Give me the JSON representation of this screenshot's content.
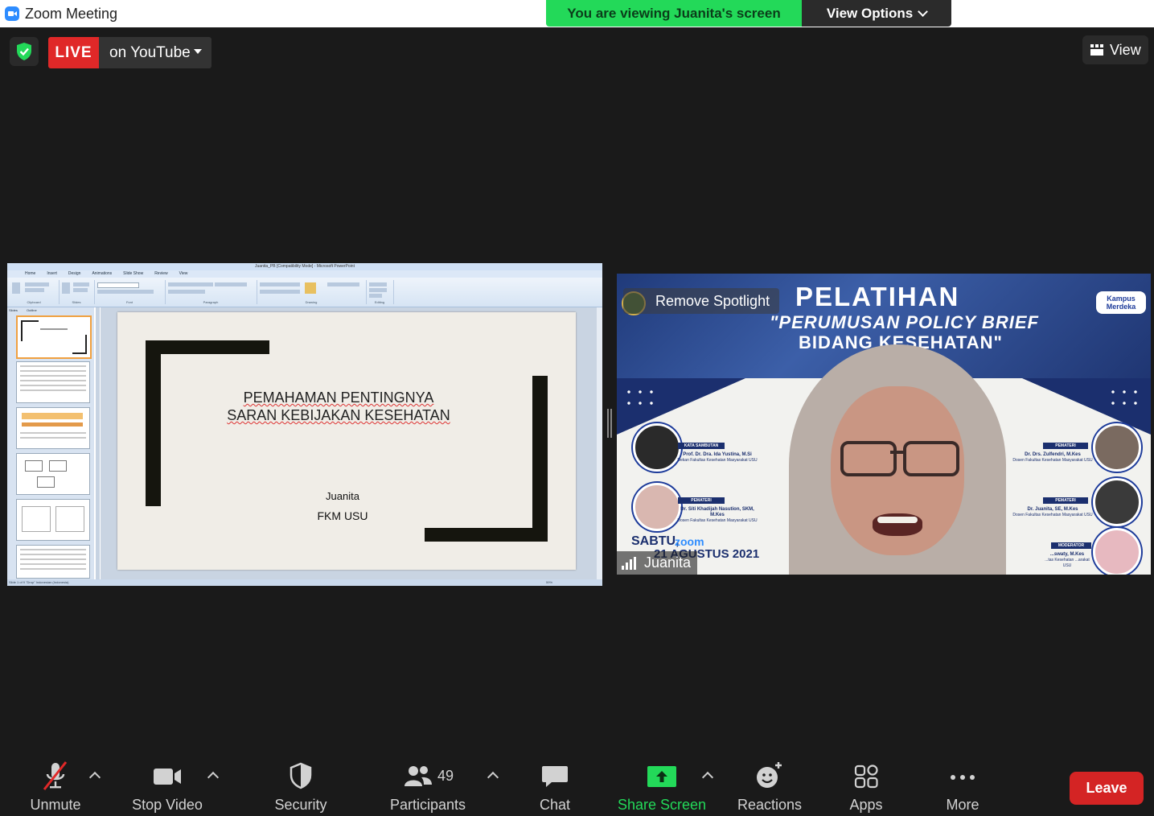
{
  "window": {
    "title": "Zoom Meeting"
  },
  "banner": {
    "viewing_text": "You are viewing Juanita's screen",
    "view_options_label": "View Options"
  },
  "live": {
    "badge": "LIVE",
    "target": "on YouTube"
  },
  "view_button": {
    "label": "View"
  },
  "shared_screen": {
    "app_title": "Juanita_PB [Compatibility Mode] - Microsoft PowerPoint",
    "ribbon_tabs": [
      "Home",
      "Insert",
      "Design",
      "Animations",
      "Slide Show",
      "Review",
      "View"
    ],
    "ribbon_groups": [
      "Clipboard",
      "Slides",
      "Font",
      "Paragraph",
      "Drawing",
      "Editing"
    ],
    "pane_tabs": [
      "Slides",
      "Outline"
    ],
    "slide": {
      "title_line1": "PEMAHAMAN PENTINGNYA",
      "title_line2": "SARAN KEBIJAKAN KESEHATAN",
      "author": "Juanita",
      "org": "FKM USU"
    },
    "status": "Slide 1 of 9   \"Drop\"   Indonesian (Indonesia)",
    "zoom_level": "59%"
  },
  "video": {
    "remove_spotlight": "Remove Spotlight",
    "participant_name": "Juanita",
    "poster": {
      "title": "PELATIHAN",
      "sub1": "\"PERUMUSAN POLICY BRIEF",
      "sub2": "BIDANG KESEHATAN\"",
      "badge_line1": "Kampus",
      "badge_line2": "Merdeka",
      "left_tag1": "KATA SAMBUTAN",
      "left_name1": "Prof. Dr. Dra. Ida Yustina, M.Si",
      "left_role1": "Dekan Fakultas Kesehatan Masyarakat USU",
      "left_tag2": "PEMATERI",
      "left_name2": "Dr. Siti Khadijah Nasution, SKM, M.Kes",
      "left_role2": "Dosen Fakultas Kesehatan Masyarakat USU",
      "right_tag1": "PEMATERI",
      "right_name1": "Dr. Drs. Zulfendri, M.Kes",
      "right_role1": "Dosen Fakultas Kesehatan Masyarakat USU",
      "right_tag2": "PEMATERI",
      "right_name2": "Dr. Juanita, SE, M.Kes",
      "right_role2": "Dosen Fakultas Kesehatan Masyarakat USU",
      "right_tag3": "MODERATOR",
      "right_name3": "...swaty, M.Kes",
      "right_role3": "...tas Kesehatan ...arakat USU",
      "day": "SABTU,",
      "zoom": "zoom",
      "date": "21 AGUSTUS 2021"
    }
  },
  "toolbar": {
    "unmute": "Unmute",
    "stop_video": "Stop Video",
    "security": "Security",
    "participants": "Participants",
    "participant_count": "49",
    "chat": "Chat",
    "share_screen": "Share Screen",
    "reactions": "Reactions",
    "apps": "Apps",
    "more": "More",
    "leave": "Leave"
  },
  "colors": {
    "accent_green": "#23d959",
    "live_red": "#e02828",
    "leave_red": "#d42424",
    "background": "#1a1a1a"
  }
}
